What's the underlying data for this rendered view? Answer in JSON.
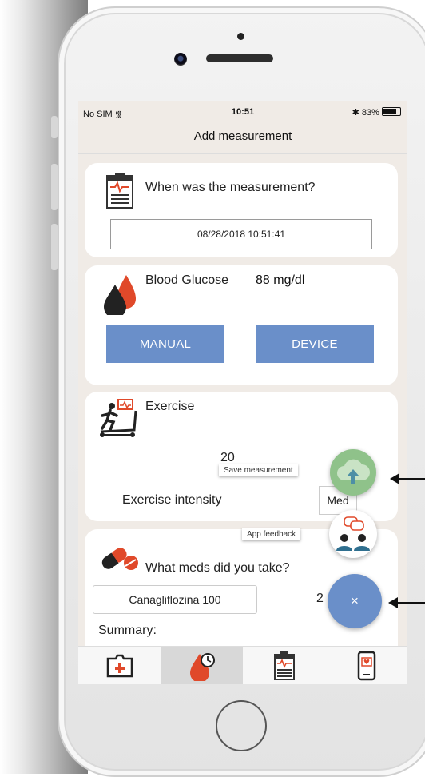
{
  "status_bar": {
    "carrier": "No SIM",
    "time": "10:51",
    "battery": "83%"
  },
  "nav": {
    "title": "Add measurement"
  },
  "when_card": {
    "question": "When was the measurement?",
    "datetime_value": "08/28/2018 10:51:41"
  },
  "glucose_card": {
    "label": "Blood Glucose",
    "value": "88 mg/dl",
    "manual_label": "MANUAL",
    "device_label": "DEVICE"
  },
  "exercise_card": {
    "label": "Exercise",
    "duration_value": "20",
    "intensity_label": "Exercise intensity",
    "intensity_value": "Med"
  },
  "meds_card": {
    "question": "What meds did you take?",
    "med_name": "Canagliflozina 100",
    "med_qty": "2",
    "summary_label": "Summary:"
  },
  "fab": {
    "save_tooltip": "Save measurement",
    "feedback_tooltip": "App feedback",
    "close_label": "×"
  },
  "tabs": [
    {
      "name": "medical-kit-icon",
      "active": false
    },
    {
      "name": "glucose-clock-icon",
      "active": true
    },
    {
      "name": "clipboard-icon",
      "active": false
    },
    {
      "name": "phone-heart-icon",
      "active": false
    }
  ],
  "colors": {
    "accent_blue": "#6a8fc9",
    "brand_red": "#e0492a",
    "save_green": "#8fc28a"
  }
}
